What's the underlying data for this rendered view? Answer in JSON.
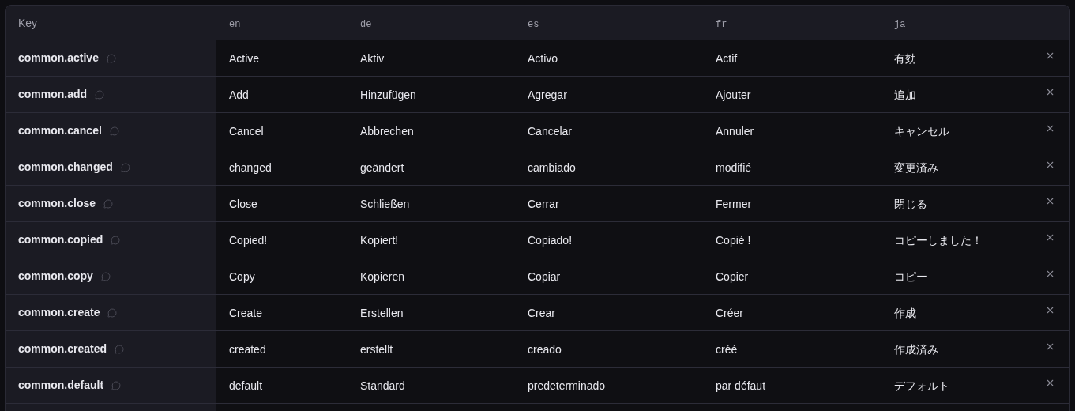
{
  "table": {
    "key_header": "Key",
    "languages": [
      "en",
      "de",
      "es",
      "fr",
      "ja"
    ],
    "rows": [
      {
        "key": "common.active",
        "values": [
          "Active",
          "Aktiv",
          "Activo",
          "Actif",
          "有効"
        ]
      },
      {
        "key": "common.add",
        "values": [
          "Add",
          "Hinzufügen",
          "Agregar",
          "Ajouter",
          "追加"
        ]
      },
      {
        "key": "common.cancel",
        "values": [
          "Cancel",
          "Abbrechen",
          "Cancelar",
          "Annuler",
          "キャンセル"
        ]
      },
      {
        "key": "common.changed",
        "values": [
          "changed",
          "geändert",
          "cambiado",
          "modifié",
          "変更済み"
        ]
      },
      {
        "key": "common.close",
        "values": [
          "Close",
          "Schließen",
          "Cerrar",
          "Fermer",
          "閉じる"
        ]
      },
      {
        "key": "common.copied",
        "values": [
          "Copied!",
          "Kopiert!",
          "Copiado!",
          "Copié !",
          "コピーしました！"
        ]
      },
      {
        "key": "common.copy",
        "values": [
          "Copy",
          "Kopieren",
          "Copiar",
          "Copier",
          "コピー"
        ]
      },
      {
        "key": "common.create",
        "values": [
          "Create",
          "Erstellen",
          "Crear",
          "Créer",
          "作成"
        ]
      },
      {
        "key": "common.created",
        "values": [
          "created",
          "erstellt",
          "creado",
          "créé",
          "作成済み"
        ]
      },
      {
        "key": "common.default",
        "values": [
          "default",
          "Standard",
          "predeterminado",
          "par défaut",
          "デフォルト"
        ]
      }
    ]
  }
}
